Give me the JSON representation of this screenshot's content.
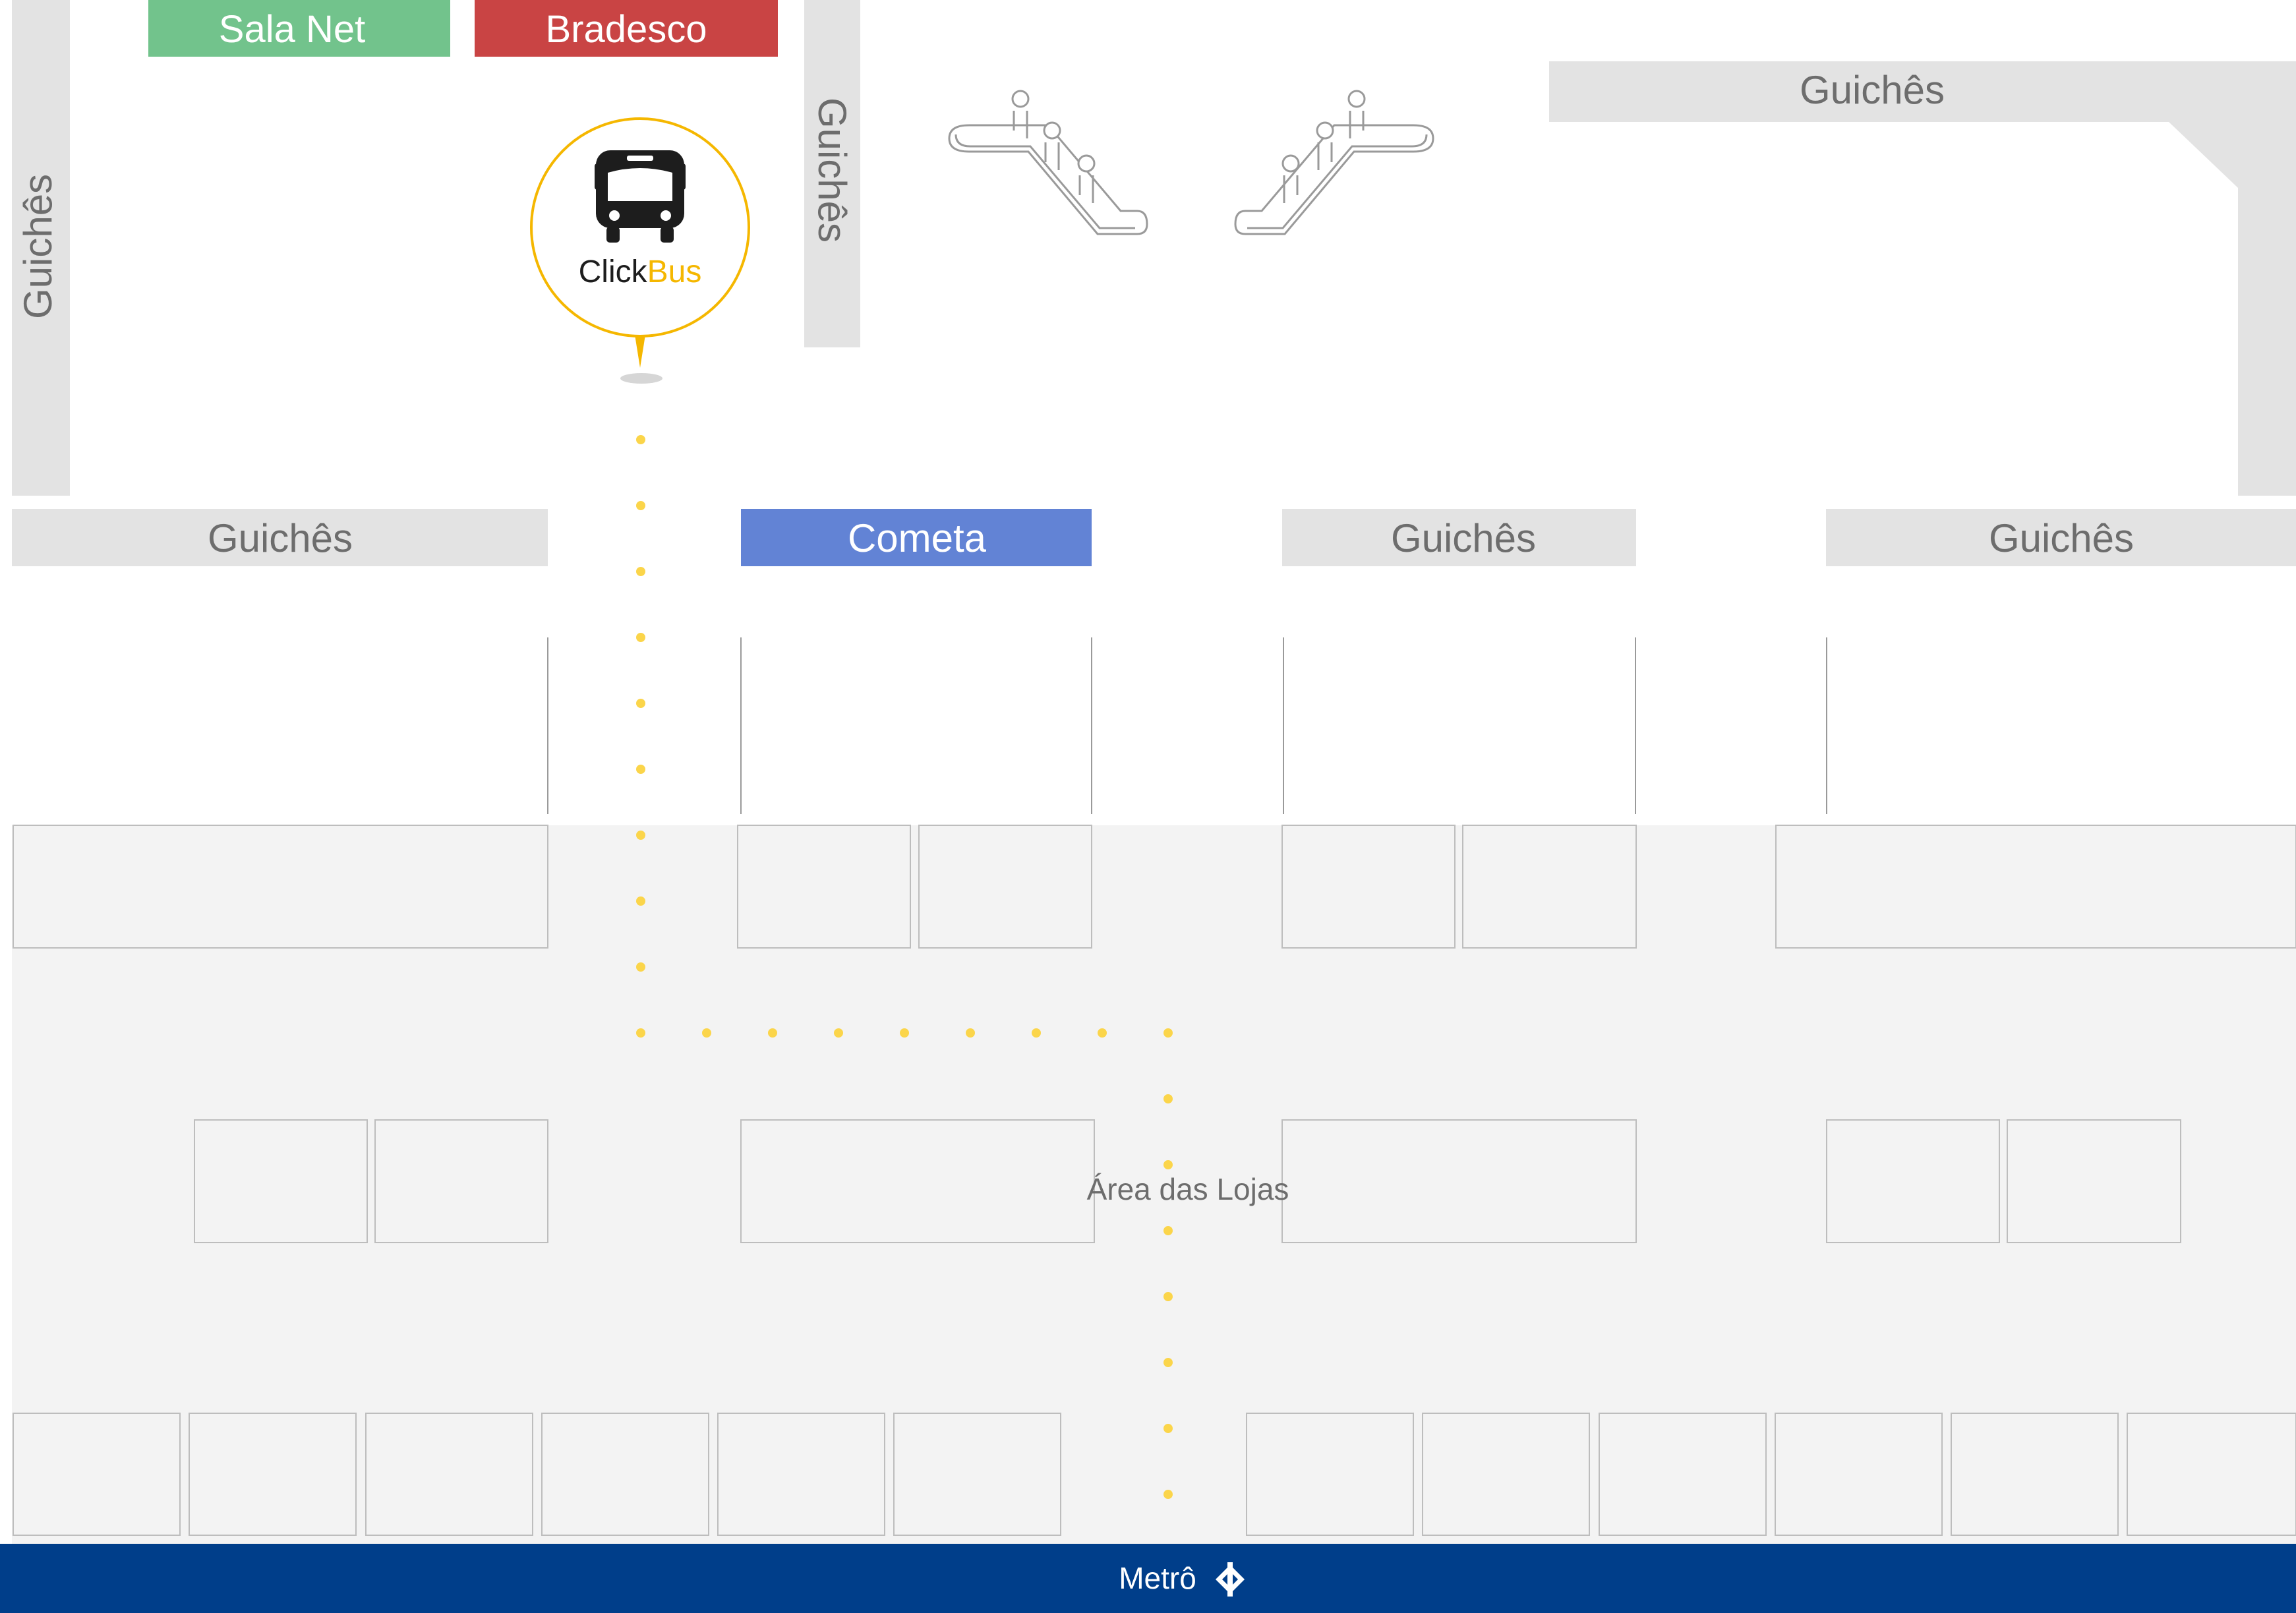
{
  "map": {
    "counters_label": "Guichês",
    "sala_net": "Sala Net",
    "bradesco": "Bradesco",
    "cometa": "Cometa",
    "clickbus": {
      "part1": "Click",
      "part2": "Bus"
    },
    "stores_area": "Área das Lojas",
    "metro": "Metrô"
  },
  "colors": {
    "counter_bg": "#e3e3e3",
    "counter_text": "#6d6d6d",
    "sala_net": "#72c38c",
    "bradesco": "#c94444",
    "cometa": "#6283d5",
    "clickbus_accent": "#f5b700",
    "route_dot": "#fbd54a",
    "store_area_bg": "#f3f3f3",
    "store_border": "#bdbdbd",
    "metro_bar": "#003e8a"
  },
  "icons": [
    "bus-icon",
    "escalator-icon",
    "metro-logo-icon",
    "map-pin-icon"
  ]
}
